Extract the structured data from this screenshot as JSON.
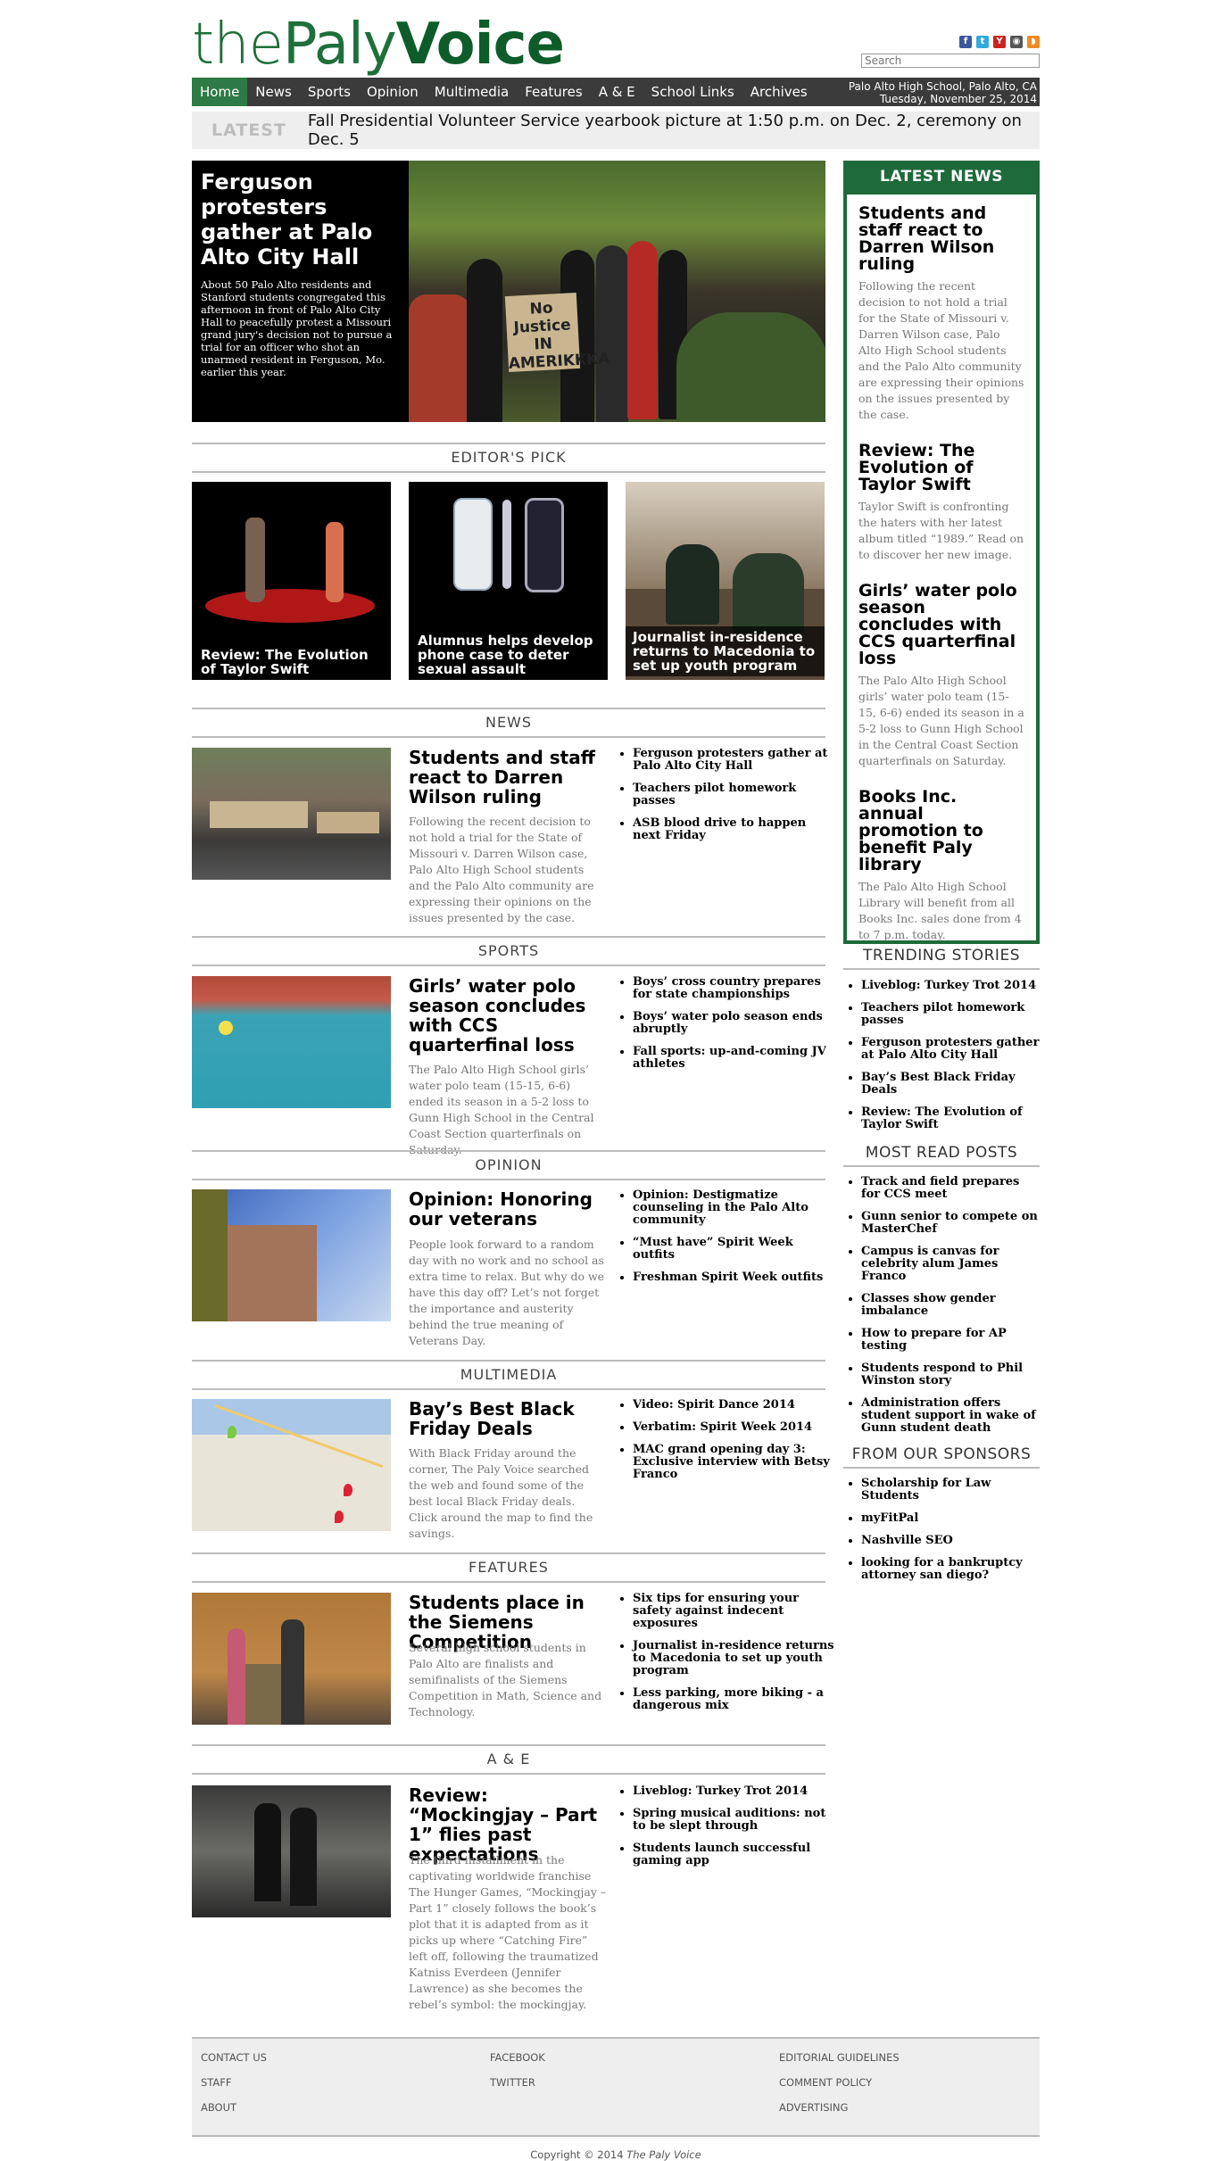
{
  "header": {
    "logo": {
      "the": "the",
      "paly": "Paly",
      "voice": "Voice"
    },
    "search_placeholder": "Search",
    "social": {
      "facebook": "f",
      "twitter": "t",
      "youtube": "Y",
      "instagram": "◉",
      "rss": "◗"
    }
  },
  "nav": {
    "items": [
      "Home",
      "News",
      "Sports",
      "Opinion",
      "Multimedia",
      "Features",
      "A & E",
      "School Links",
      "Archives"
    ],
    "location": "Palo Alto High School, Palo Alto, CA",
    "date": "Tuesday, November 25, 2014"
  },
  "ticker": {
    "label": "LATEST",
    "text": "Fall Presidential Volunteer Service yearbook picture at 1:50 p.m. on Dec. 2, ceremony on Dec. 5"
  },
  "hero": {
    "title": "Ferguson protesters gather at Palo Alto City Hall",
    "summary": "About 50 Palo Alto residents and Stanford students congregated this afternoon in front of Palo Alto City Hall to peacefully protest a Missouri grand jury's decision not to pursue a trial for an officer who shot an unarmed resident in Ferguson, Mo. earlier this year.",
    "sign": "No Justice IN AMERIKKKA"
  },
  "editors_pick": {
    "heading": "EDITOR'S PICK",
    "items": [
      "Review: The Evolution of Taylor Swift",
      "Alumnus helps develop phone case to deter sexual assault",
      "Journalist in-residence returns to Macedonia to set up youth program"
    ]
  },
  "sections": {
    "news": {
      "heading": "NEWS",
      "title": "Students and staff react to Darren Wilson ruling",
      "summary": "Following the recent decision to not hold a trial for the State of Missouri v. Darren Wilson case, Palo Alto High School students and the Palo Alto community are expressing their opinions on the issues presented by the case.",
      "links": [
        "Ferguson protesters gather at Palo Alto City Hall",
        "Teachers pilot homework passes",
        "ASB blood drive to happen next Friday"
      ]
    },
    "sports": {
      "heading": "SPORTS",
      "title": "Girls’ water polo season concludes with CCS quarterfinal loss",
      "summary": "The Palo Alto High School girls’ water polo team (15-15, 6-6) ended its season in a 5-2 loss to Gunn High School in the Central Coast Section quarterfinals on Saturday.",
      "links": [
        "Boys’ cross country prepares for state championships",
        "Boys’ water polo season ends abruptly",
        "Fall sports: up-and-coming JV athletes"
      ]
    },
    "opinion": {
      "heading": "OPINION",
      "title": "Opinion: Honoring our veterans",
      "summary": "People look forward to a random day with no work and no school as extra time to relax. But why do we have this day off? Let’s not forget the importance and austerity behind the true meaning of Veterans Day.",
      "links": [
        "Opinion: Destigmatize counseling in the Palo Alto community",
        "“Must have” Spirit Week outfits",
        "Freshman Spirit Week outfits"
      ]
    },
    "multimedia": {
      "heading": "MULTIMEDIA",
      "title": "Bay’s Best Black Friday Deals",
      "summary": "With Black Friday around the corner, The Paly Voice searched the web and found some of the best local Black Friday deals. Click around the map to find the savings.",
      "links": [
        "Video: Spirit Dance 2014",
        "Verbatim: Spirit Week 2014",
        "MAC grand opening day 3: Exclusive interview with Betsy Franco"
      ]
    },
    "features": {
      "heading": "FEATURES",
      "title": "Students place in the Siemens Competition",
      "summary": "Several high school students in Palo Alto are finalists and semifinalists of the Siemens Competition in Math, Science and Technology.",
      "links": [
        "Six tips for ensuring your safety against indecent exposures",
        "Journalist in-residence returns to Macedonia to set up youth program",
        "Less parking, more biking - a dangerous mix"
      ]
    },
    "ae": {
      "heading": "A & E",
      "title": "Review: “Mockingjay – Part 1” flies past expectations",
      "summary": "The third installment in the captivating worldwide franchise The Hunger Games, “Mockingjay – Part 1” closely follows the book’s plot that it is adapted from as it picks up where “Catching Fire” left off, following the traumatized Katniss Everdeen (Jennifer Lawrence) as she becomes the rebel’s symbol: the mockingjay.",
      "links": [
        "Liveblog: Turkey Trot 2014",
        "Spring musical auditions: not to be slept through",
        "Students launch successful gaming app"
      ]
    }
  },
  "sidebar": {
    "latest": {
      "heading": "LATEST NEWS",
      "items": [
        {
          "title": "Students and staff react to Darren Wilson ruling",
          "summary": "Following the recent decision to not hold a trial for the State of Missouri v. Darren Wilson case, Palo Alto High School students and the Palo Alto community are expressing their opinions on the issues presented by the case."
        },
        {
          "title": "Review: The Evolution of Taylor Swift",
          "summary": "Taylor Swift is confronting the haters with her latest album titled “1989.” Read on to discover her new image."
        },
        {
          "title": "Girls’ water polo season concludes with CCS quarterfinal loss",
          "summary": "The Palo Alto High School girls’ water polo team (15-15, 6-6) ended its season in a 5-2 loss to Gunn High School in the Central Coast Section quarterfinals on Saturday."
        },
        {
          "title": "Books Inc. annual promotion to benefit Paly library",
          "summary": "The Palo Alto High School Library will benefit from all Books Inc. sales done from 4 to 7 p.m. today."
        }
      ]
    },
    "trending": {
      "heading": "TRENDING STORIES",
      "items": [
        "Liveblog: Turkey Trot 2014",
        "Teachers pilot homework passes",
        "Ferguson protesters gather at Palo Alto City Hall",
        "Bay’s Best Black Friday Deals",
        "Review: The Evolution of Taylor Swift"
      ]
    },
    "most_read": {
      "heading": "MOST READ POSTS",
      "items": [
        "Track and field prepares for CCS meet",
        "Gunn senior to compete on MasterChef",
        "Campus is canvas for celebrity alum James Franco",
        "Classes show gender imbalance",
        "How to prepare for AP testing",
        "Students respond to Phil Winston story",
        "Administration offers student support in wake of Gunn student death"
      ]
    },
    "sponsors": {
      "heading": "FROM OUR SPONSORS",
      "items": [
        "Scholarship for Law Students",
        "myFitPal",
        "Nashville SEO",
        "looking for a bankruptcy attorney san diego?"
      ]
    }
  },
  "footer": {
    "col1": [
      "CONTACT US",
      "STAFF",
      "ABOUT"
    ],
    "col2": [
      "FACEBOOK",
      "TWITTER"
    ],
    "col3": [
      "EDITORIAL GUIDELINES",
      "COMMENT POLICY",
      "ADVERTISING"
    ],
    "copyright_prefix": "Copyright © 2014",
    "copyright_name": "The Paly Voice"
  },
  "colors": {
    "brand_green": "#1e6a3a",
    "nav_bg": "#3b3b3b",
    "nav_active": "#2d7a45"
  }
}
